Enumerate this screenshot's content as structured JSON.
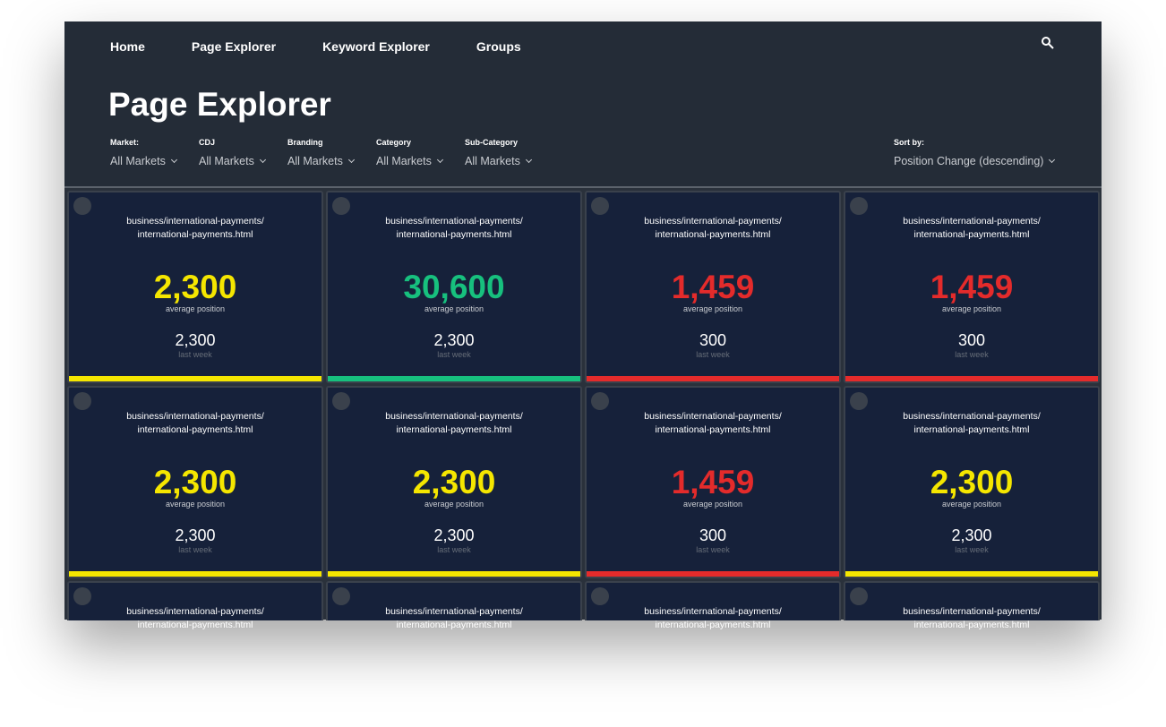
{
  "nav": [
    "Home",
    "Page Explorer",
    "Keyword Explorer",
    "Groups"
  ],
  "title": "Page Explorer",
  "filters": [
    {
      "label": "Market:",
      "value": "All Markets"
    },
    {
      "label": "CDJ",
      "value": "All Markets"
    },
    {
      "label": "Branding",
      "value": "All Markets"
    },
    {
      "label": "Category",
      "value": "All Markets"
    },
    {
      "label": "Sub-Category",
      "value": "All Markets"
    }
  ],
  "sort": {
    "label": "Sort by:",
    "value": "Position Change (descending)"
  },
  "colors": {
    "yellow": "#f5e600",
    "green": "#17c07e",
    "red": "#e42b2b"
  },
  "cards": [
    {
      "url": "business/international-payments/\ninternational-payments.html",
      "value": "2,300",
      "value_label": "average position",
      "last": "2,300",
      "last_label": "last week",
      "status": "yellow"
    },
    {
      "url": "business/international-payments/\ninternational-payments.html",
      "value": "30,600",
      "value_label": "average position",
      "last": "2,300",
      "last_label": "last week",
      "status": "green"
    },
    {
      "url": "business/international-payments/\ninternational-payments.html",
      "value": "1,459",
      "value_label": "average position",
      "last": "300",
      "last_label": "last week",
      "status": "red"
    },
    {
      "url": "business/international-payments/\ninternational-payments.html",
      "value": "1,459",
      "value_label": "average position",
      "last": "300",
      "last_label": "last week",
      "status": "red"
    },
    {
      "url": "business/international-payments/\ninternational-payments.html",
      "value": "2,300",
      "value_label": "average position",
      "last": "2,300",
      "last_label": "last week",
      "status": "yellow"
    },
    {
      "url": "business/international-payments/\ninternational-payments.html",
      "value": "2,300",
      "value_label": "average position",
      "last": "2,300",
      "last_label": "last week",
      "status": "yellow"
    },
    {
      "url": "business/international-payments/\ninternational-payments.html",
      "value": "1,459",
      "value_label": "average position",
      "last": "300",
      "last_label": "last week",
      "status": "red"
    },
    {
      "url": "business/international-payments/\ninternational-payments.html",
      "value": "2,300",
      "value_label": "average position",
      "last": "2,300",
      "last_label": "last week",
      "status": "yellow"
    },
    {
      "url": "business/international-payments/\ninternational-payments.html"
    },
    {
      "url": "business/international-payments/\ninternational-payments.html"
    },
    {
      "url": "business/international-payments/\ninternational-payments.html"
    },
    {
      "url": "business/international-payments/\ninternational-payments.html"
    }
  ]
}
